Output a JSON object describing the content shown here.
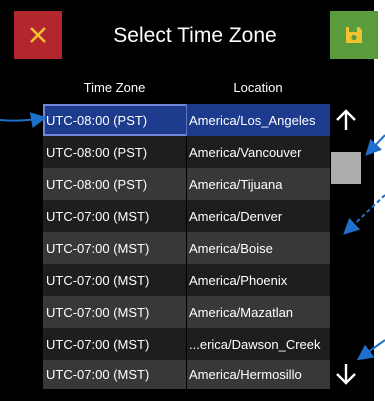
{
  "header": {
    "title": "Select Time Zone",
    "close_icon": "close-icon",
    "save_icon": "save-icon"
  },
  "table": {
    "columns": [
      "Time Zone",
      "Location"
    ],
    "rows": [
      {
        "zone": "UTC-08:00 (PST)",
        "location": "America/Los_Angeles",
        "selected": true
      },
      {
        "zone": "UTC-08:00 (PST)",
        "location": "America/Vancouver"
      },
      {
        "zone": "UTC-08:00 (PST)",
        "location": "America/Tijuana"
      },
      {
        "zone": "UTC-07:00 (MST)",
        "location": "America/Denver"
      },
      {
        "zone": "UTC-07:00 (MST)",
        "location": "America/Boise"
      },
      {
        "zone": "UTC-07:00 (MST)",
        "location": "America/Phoenix"
      },
      {
        "zone": "UTC-07:00 (MST)",
        "location": "America/Mazatlan"
      },
      {
        "zone": "UTC-07:00 (MST)",
        "location": "...erica/Dawson_Creek"
      },
      {
        "zone": "UTC-07:00 (MST)",
        "location": "America/Hermosillo"
      }
    ]
  },
  "scrollbar": {
    "up_icon": "arrow-up-icon",
    "down_icon": "arrow-down-icon"
  },
  "colors": {
    "close_button": "#b3262e",
    "save_button": "#5a9b3c",
    "selected_row": "#1c3b8d",
    "callout": "#1e6fc9",
    "thumb": "#adadad"
  }
}
